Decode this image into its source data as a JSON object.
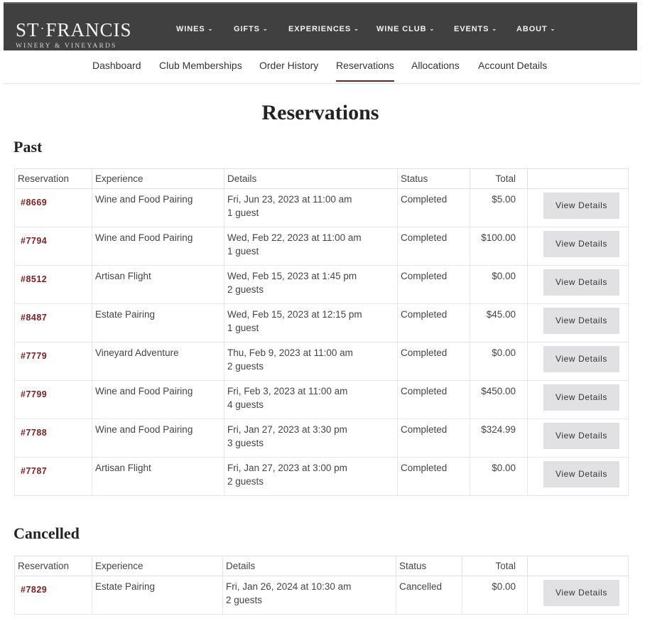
{
  "brand": {
    "name_left": "ST",
    "name_dot": "·",
    "name_right": "FRANCIS",
    "tagline": "WINERY & VINEYARDS"
  },
  "menu": [
    {
      "label": "WINES"
    },
    {
      "label": "GIFTS"
    },
    {
      "label": "EXPERIENCES"
    },
    {
      "label": "WINE CLUB"
    },
    {
      "label": "EVENTS"
    },
    {
      "label": "ABOUT"
    }
  ],
  "subnav": [
    {
      "label": "Dashboard"
    },
    {
      "label": "Club Memberships"
    },
    {
      "label": "Order History"
    },
    {
      "label": "Reservations",
      "active": true
    },
    {
      "label": "Allocations"
    },
    {
      "label": "Account Details"
    }
  ],
  "page_title": "Reservations",
  "columns": {
    "reservation": "Reservation",
    "experience": "Experience",
    "details": "Details",
    "status": "Status",
    "total": "Total"
  },
  "view_label": "View Details",
  "past": {
    "title": "Past",
    "rows": [
      {
        "id": "#8669",
        "experience": "Wine and Food Pairing",
        "date": "Fri, Jun 23, 2023 at 11:00 am",
        "guests": "1 guest",
        "status": "Completed",
        "total": "$5.00"
      },
      {
        "id": "#7794",
        "experience": "Wine and Food Pairing",
        "date": "Wed, Feb 22, 2023 at 11:00 am",
        "guests": "1 guest",
        "status": "Completed",
        "total": "$100.00"
      },
      {
        "id": "#8512",
        "experience": "Artisan Flight",
        "date": "Wed, Feb 15, 2023 at 1:45 pm",
        "guests": "2 guests",
        "status": "Completed",
        "total": "$0.00"
      },
      {
        "id": "#8487",
        "experience": "Estate Pairing",
        "date": "Wed, Feb 15, 2023 at 12:15 pm",
        "guests": "1 guest",
        "status": "Completed",
        "total": "$45.00"
      },
      {
        "id": "#7779",
        "experience": "Vineyard Adventure",
        "date": "Thu, Feb 9, 2023 at 11:00 am",
        "guests": "2 guests",
        "status": "Completed",
        "total": "$0.00"
      },
      {
        "id": "#7799",
        "experience": "Wine and Food Pairing",
        "date": "Fri, Feb 3, 2023 at 11:00 am",
        "guests": "4 guests",
        "status": "Completed",
        "total": "$450.00"
      },
      {
        "id": "#7788",
        "experience": "Wine and Food Pairing",
        "date": "Fri, Jan 27, 2023 at 3:30 pm",
        "guests": "3 guests",
        "status": "Completed",
        "total": "$324.99"
      },
      {
        "id": "#7787",
        "experience": "Artisan Flight",
        "date": "Fri, Jan 27, 2023 at 3:00 pm",
        "guests": "2 guests",
        "status": "Completed",
        "total": "$0.00"
      }
    ]
  },
  "cancelled": {
    "title": "Cancelled",
    "rows": [
      {
        "id": "#7829",
        "experience": "Estate Pairing",
        "date": "Fri, Jan 26, 2024 at 10:30 am",
        "guests": "2 guests",
        "status": "Cancelled",
        "total": "$0.00"
      }
    ]
  },
  "colors": {
    "topbar": "#404040",
    "accent": "#7a1f1f",
    "button": "#e1e1e3"
  }
}
